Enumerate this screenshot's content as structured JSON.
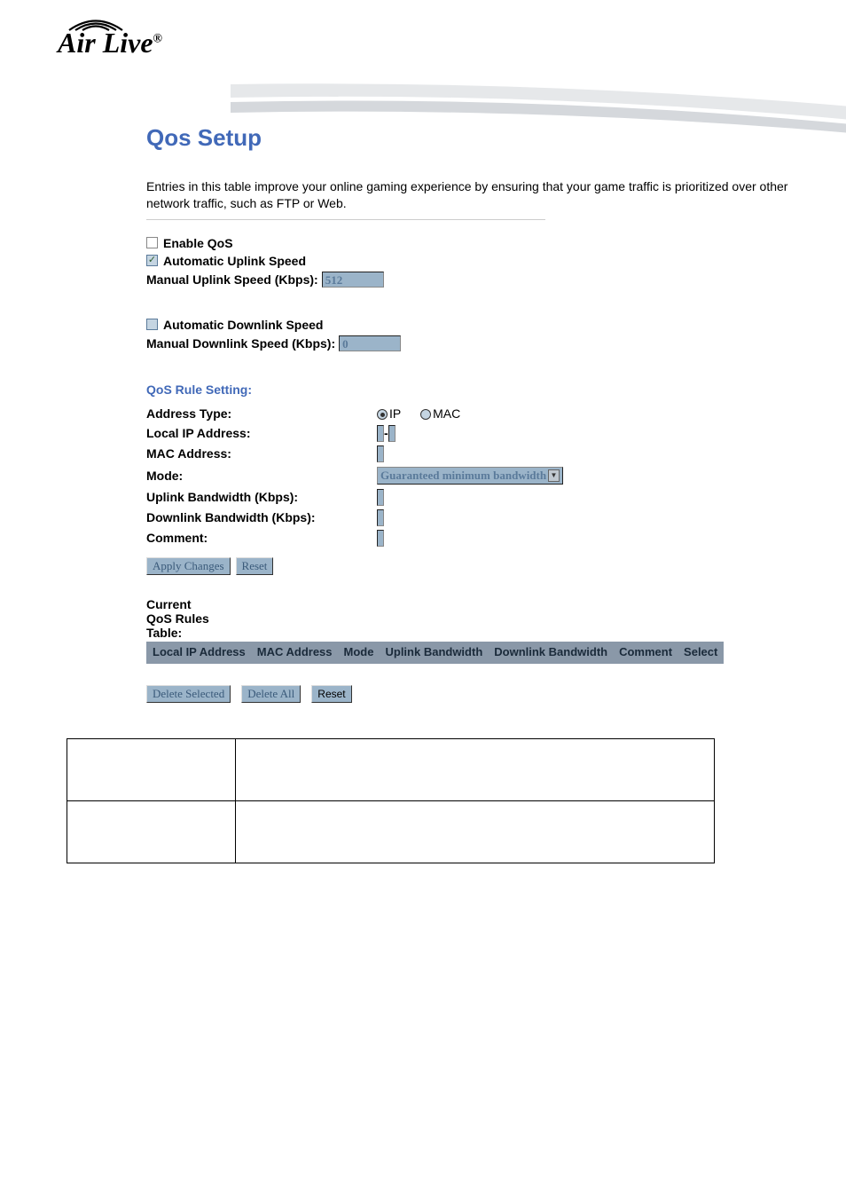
{
  "logo": {
    "text": "Air Live",
    "reg": "®"
  },
  "page": {
    "title": "Qos Setup",
    "description": "Entries in this table improve your online gaming experience by ensuring that your game traffic is prioritized over other network traffic, such as FTP or Web."
  },
  "settings": {
    "enable_qos_label": "Enable QoS",
    "auto_uplink_label": "Automatic Uplink Speed",
    "manual_uplink_label": "Manual Uplink Speed (Kbps):",
    "manual_uplink_value": "512",
    "auto_downlink_label": "Automatic Downlink Speed",
    "manual_downlink_label": "Manual Downlink Speed (Kbps):",
    "manual_downlink_value": "0"
  },
  "rule": {
    "heading": "QoS Rule Setting:",
    "address_type_label": "Address Type:",
    "radio_ip": "IP",
    "radio_mac": "MAC",
    "local_ip_label": "Local IP Address:",
    "mac_addr_label": "MAC Address:",
    "mode_label": "Mode:",
    "mode_value": "Guaranteed minimum bandwidth",
    "uplink_bw_label": "Uplink Bandwidth (Kbps):",
    "downlink_bw_label": "Downlink Bandwidth (Kbps):",
    "comment_label": "Comment:",
    "apply_btn": "Apply Changes",
    "reset_btn": "Reset"
  },
  "table": {
    "title": "Current QoS Rules Table:",
    "headers": [
      "Local IP Address",
      "MAC Address",
      "Mode",
      "Uplink Bandwidth",
      "Downlink Bandwidth",
      "Comment",
      "Select"
    ]
  },
  "actions": {
    "delete_selected": "Delete Selected",
    "delete_all": "Delete All",
    "reset": "Reset"
  }
}
